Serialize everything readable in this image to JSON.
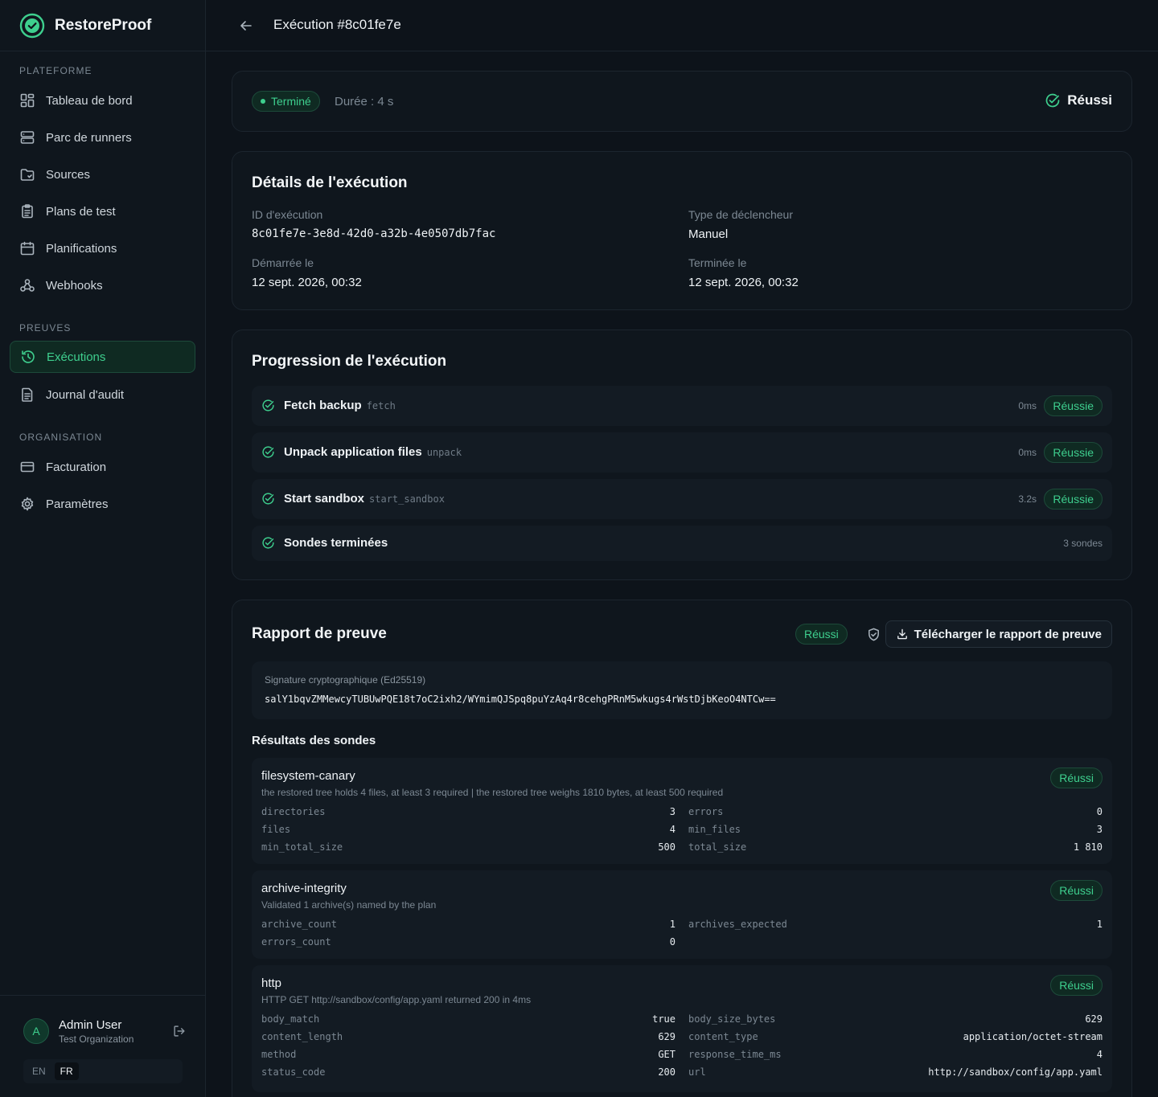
{
  "app": {
    "name": "RestoreProof"
  },
  "nav": {
    "sections": [
      "PLATEFORME",
      "PREUVES",
      "ORGANISATION"
    ],
    "items": [
      {
        "label": "Tableau de bord",
        "icon": "dashboard-icon"
      },
      {
        "label": "Parc de runners",
        "icon": "server-icon"
      },
      {
        "label": "Sources",
        "icon": "folder-icon"
      },
      {
        "label": "Plans de test",
        "icon": "clipboard-icon"
      },
      {
        "label": "Planifications",
        "icon": "calendar-icon"
      },
      {
        "label": "Webhooks",
        "icon": "webhook-icon"
      },
      {
        "label": "Exécutions",
        "icon": "history-icon",
        "active": true
      },
      {
        "label": "Journal d'audit",
        "icon": "document-icon"
      },
      {
        "label": "Facturation",
        "icon": "credit-card-icon"
      },
      {
        "label": "Paramètres",
        "icon": "gear-icon"
      }
    ]
  },
  "user": {
    "initial": "A",
    "name": "Admin User",
    "org": "Test Organization"
  },
  "lang": {
    "en": "EN",
    "fr": "FR",
    "selected": "FR"
  },
  "header": {
    "title": "Exécution #8c01fe7e"
  },
  "status": {
    "badge": "Terminé",
    "duration": "Durée : 4 s",
    "result": "Réussi"
  },
  "details": {
    "title": "Détails de l'exécution",
    "id_label": "ID d'exécution",
    "id_value": "8c01fe7e-3e8d-42d0-a32b-4e0507db7fac",
    "trigger_label": "Type de déclencheur",
    "trigger_value": "Manuel",
    "started_label": "Démarrée le",
    "started_value": "12 sept. 2026, 00:32",
    "ended_label": "Terminée le",
    "ended_value": "12 sept. 2026, 00:32"
  },
  "progress": {
    "title": "Progression de l'exécution",
    "steps": [
      {
        "name": "Fetch backup",
        "key": "fetch",
        "time": "0ms",
        "status": "Réussie"
      },
      {
        "name": "Unpack application files",
        "key": "unpack",
        "time": "0ms",
        "status": "Réussie"
      },
      {
        "name": "Start sandbox",
        "key": "start_sandbox",
        "time": "3.2s",
        "status": "Réussie"
      }
    ],
    "summary": {
      "name": "Sondes terminées",
      "count": "3 sondes"
    }
  },
  "report": {
    "title": "Rapport de preuve",
    "status": "Réussi",
    "download_label": "Télécharger le rapport de preuve",
    "signature_label": "Signature cryptographique (Ed25519)",
    "signature_value": "salY1bqvZMMewcyTUBUwPQE18t7oC2ixh2/WYmimQJSpq8puYzAq4r8cehgPRnM5wkugs4rWstDjbKeoO4NTCw==",
    "results_title": "Résultats des sondes",
    "probes": [
      {
        "name": "filesystem-canary",
        "desc": "the restored tree holds 4 files, at least 3 required | the restored tree weighs 1810 bytes, at least 500 required",
        "status": "Réussi",
        "metrics": [
          {
            "k": "directories",
            "v": "3"
          },
          {
            "k": "errors",
            "v": "0"
          },
          {
            "k": "files",
            "v": "4"
          },
          {
            "k": "min_files",
            "v": "3"
          },
          {
            "k": "min_total_size",
            "v": "500"
          },
          {
            "k": "total_size",
            "v": "1 810"
          }
        ]
      },
      {
        "name": "archive-integrity",
        "desc": "Validated 1 archive(s) named by the plan",
        "status": "Réussi",
        "metrics": [
          {
            "k": "archive_count",
            "v": "1"
          },
          {
            "k": "archives_expected",
            "v": "1"
          },
          {
            "k": "errors_count",
            "v": "0"
          }
        ]
      },
      {
        "name": "http",
        "desc": "HTTP GET http://sandbox/config/app.yaml returned 200 in 4ms",
        "status": "Réussi",
        "metrics": [
          {
            "k": "body_match",
            "v": "true"
          },
          {
            "k": "body_size_bytes",
            "v": "629"
          },
          {
            "k": "content_length",
            "v": "629"
          },
          {
            "k": "content_type",
            "v": "application/octet-stream"
          },
          {
            "k": "method",
            "v": "GET"
          },
          {
            "k": "response_time_ms",
            "v": "4"
          },
          {
            "k": "status_code",
            "v": "200"
          },
          {
            "k": "url",
            "v": "http://sandbox/config/app.yaml"
          }
        ]
      }
    ]
  },
  "colors": {
    "accent": "#3ecf8e",
    "background": "#0d131a",
    "panel": "#0f161d"
  }
}
